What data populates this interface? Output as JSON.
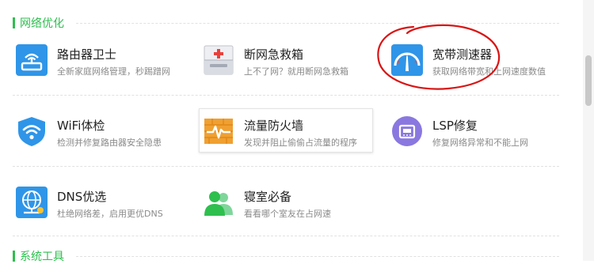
{
  "sections": {
    "network": {
      "title": "网络优化"
    },
    "system": {
      "title": "系统工具"
    }
  },
  "tools": [
    {
      "name": "路由器卫士",
      "desc": "全新家庭网络管理，秒踢蹭网",
      "icon": "router-icon",
      "color": "#2f95e8"
    },
    {
      "name": "断网急救箱",
      "desc": "上不了网？就用断网急救箱",
      "icon": "first-aid-kit-icon",
      "color": "#e8413c"
    },
    {
      "name": "宽带测速器",
      "desc": "获取网络带宽和上网速度数值",
      "icon": "speedometer-icon",
      "color": "#2f95e8"
    },
    {
      "name": "WiFi体检",
      "desc": "检测并修复路由器安全隐患",
      "icon": "wifi-shield-icon",
      "color": "#2f95e8"
    },
    {
      "name": "流量防火墙",
      "desc": "发现并阻止偷偷占流量的程序",
      "icon": "firewall-icon",
      "color": "#f0a030"
    },
    {
      "name": "LSP修复",
      "desc": "修复网络异常和不能上网",
      "icon": "lsp-repair-icon",
      "color": "#8a78e0"
    },
    {
      "name": "DNS优选",
      "desc": "杜绝网络差，启用更优DNS",
      "icon": "dns-globe-icon",
      "color": "#2f95e8"
    },
    {
      "name": "寝室必备",
      "desc": "看看哪个室友在占网速",
      "icon": "roommates-icon",
      "color": "#2ebf4f"
    }
  ]
}
